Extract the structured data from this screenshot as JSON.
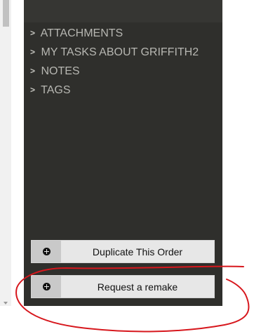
{
  "sidebar": {
    "items": [
      {
        "label": "ATTACHMENTS"
      },
      {
        "label": "MY TASKS ABOUT GRIFFITH2"
      },
      {
        "label": "NOTES"
      },
      {
        "label": "TAGS"
      }
    ],
    "buttons": {
      "duplicate": "Duplicate This Order",
      "remake": "Request a remake"
    }
  },
  "icons": {
    "chevron": "chevron-right-icon",
    "add": "plus-circle-icon"
  },
  "colors": {
    "panel_bg": "#2f2f2c",
    "menu_text": "#b7b7b2",
    "button_bg": "#e7e7e7",
    "annotation": "#d7171d"
  }
}
